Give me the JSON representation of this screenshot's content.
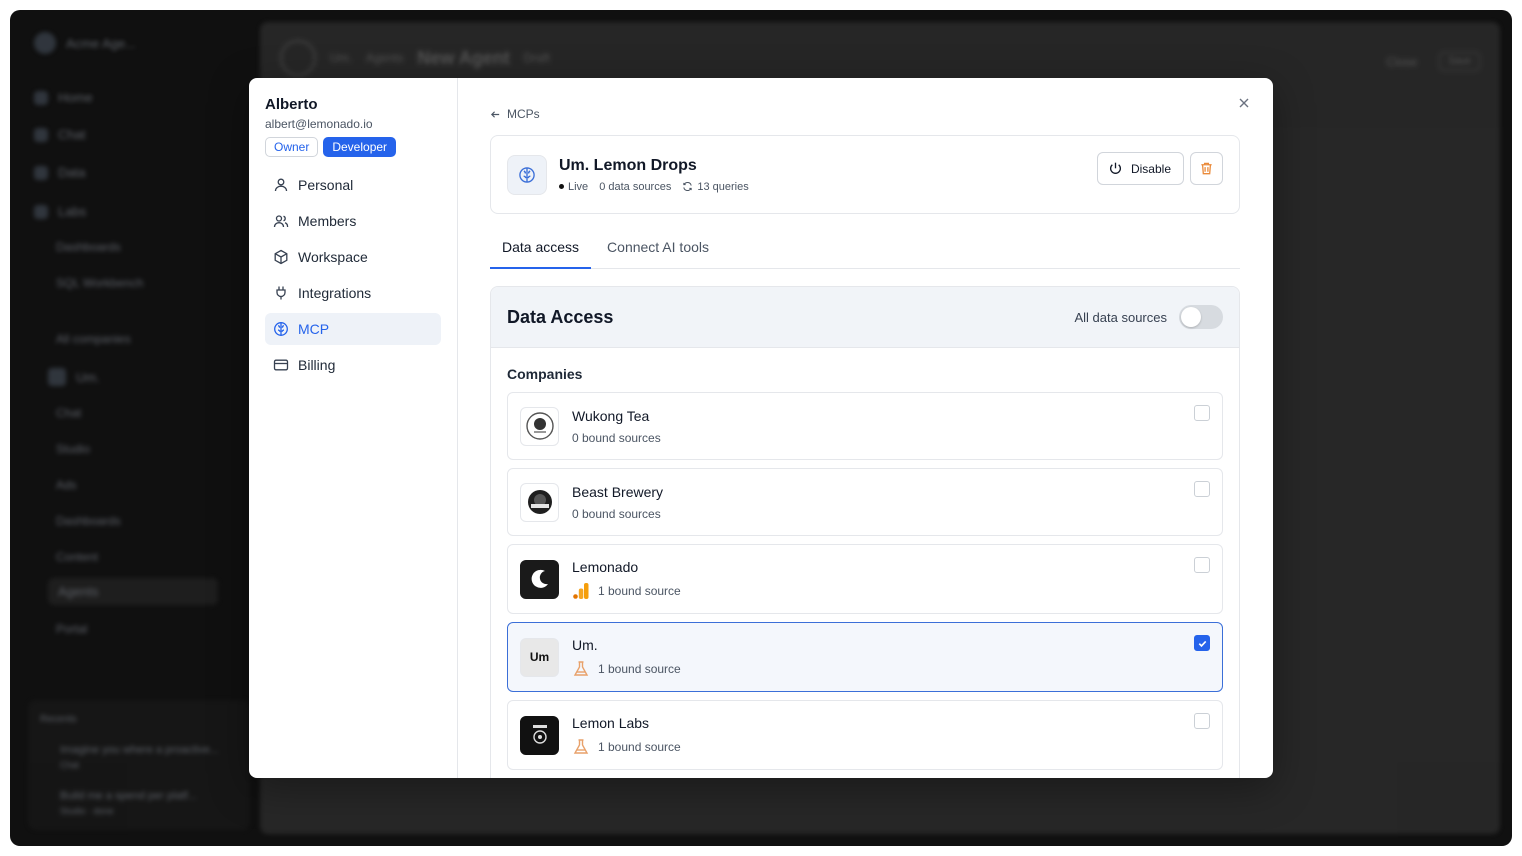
{
  "background": {
    "workspace_name": "Acme Age...",
    "sidebar_items": [
      "Home",
      "Chat",
      "Data",
      "Labs",
      "Dashboards",
      "SQL Workbench",
      "All companies",
      "Um.",
      "Chat",
      "Studio",
      "Ads",
      "Dashboards",
      "Content",
      "Agents",
      "Portal"
    ],
    "breadcrumb": [
      "Um.",
      "Agents"
    ],
    "page_title": "New Agent",
    "page_badge": "Draft",
    "actions": [
      "Close",
      "Save"
    ],
    "recents_label": "Recents",
    "recents": [
      {
        "title": "Imagine you where a proactive...",
        "sub": "Chat"
      },
      {
        "title": "Build me a spend per platf...",
        "sub": "Studio · done"
      }
    ]
  },
  "modal": {
    "user": {
      "name": "Alberto",
      "email": "albert@lemonado.io",
      "roles": [
        "Owner",
        "Developer"
      ]
    },
    "nav": [
      {
        "label": "Personal",
        "icon": "user-icon"
      },
      {
        "label": "Members",
        "icon": "users-icon"
      },
      {
        "label": "Workspace",
        "icon": "cube-icon"
      },
      {
        "label": "Integrations",
        "icon": "plug-icon"
      },
      {
        "label": "MCP",
        "icon": "brain-icon",
        "active": true
      },
      {
        "label": "Billing",
        "icon": "credit-card-icon"
      }
    ],
    "back_label": "MCPs",
    "agent": {
      "name": "Um. Lemon Drops",
      "status": "Live",
      "data_sources": "0 data sources",
      "queries": "13 queries",
      "disable_label": "Disable"
    },
    "tabs": [
      {
        "label": "Data access",
        "active": true
      },
      {
        "label": "Connect AI tools",
        "active": false
      }
    ],
    "data_access": {
      "title": "Data Access",
      "toggle_label": "All data sources",
      "toggle_on": false,
      "section_title": "Companies",
      "companies": [
        {
          "name": "Wukong Tea",
          "sources": "0 bound sources",
          "checked": false,
          "logo": "wukong-tea-logo",
          "source_icon": ""
        },
        {
          "name": "Beast Brewery",
          "sources": "0 bound sources",
          "checked": false,
          "logo": "beast-brewery-logo",
          "source_icon": ""
        },
        {
          "name": "Lemonado",
          "sources": "1 bound source",
          "checked": false,
          "logo": "lemonado-logo",
          "source_icon": "analytics-icon"
        },
        {
          "name": "Um.",
          "sources": "1 bound source",
          "checked": true,
          "logo": "um-logo",
          "logo_text": "Um",
          "source_icon": "flask-icon"
        },
        {
          "name": "Lemon Labs",
          "sources": "1 bound source",
          "checked": false,
          "logo": "lemon-labs-logo",
          "source_icon": "flask-icon"
        }
      ]
    },
    "colors": {
      "accent": "#2563eb",
      "analytics_orange": "#f59e0b",
      "flask_orange": "#e8a16a",
      "trash_orange": "#ea8a3a"
    }
  }
}
